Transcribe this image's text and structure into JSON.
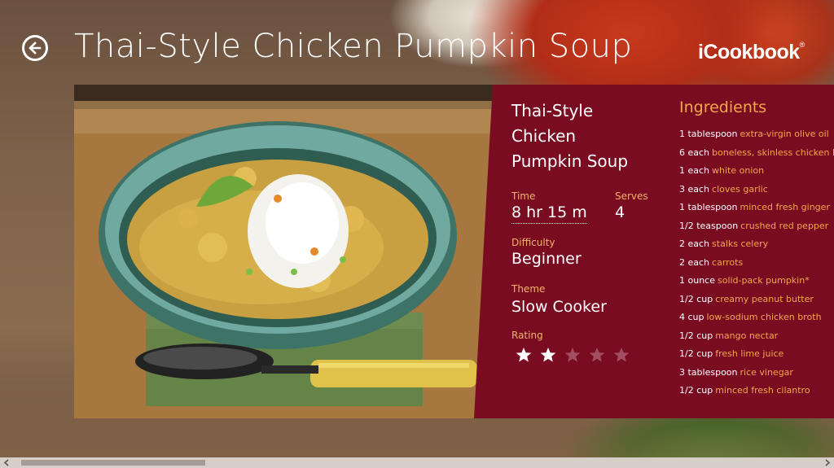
{
  "header": {
    "title": "Thai-Style Chicken Pumpkin Soup",
    "logo_text": "iCookbook",
    "logo_tm": "®"
  },
  "details": {
    "name_lines": [
      "Thai-Style",
      "Chicken",
      "Pumpkin Soup"
    ],
    "time_label": "Time",
    "time_value": "8 hr 15 m",
    "serves_label": "Serves",
    "serves_value": "4",
    "difficulty_label": "Difficulty",
    "difficulty_value": "Beginner",
    "theme_label": "Theme",
    "theme_value": "Slow Cooker",
    "rating_label": "Rating",
    "rating": 2,
    "rating_max": 5
  },
  "ingredients": {
    "title": "Ingredients",
    "items": [
      {
        "qty": "1 tablespoon",
        "name": "extra-virgin olive oil"
      },
      {
        "qty": "6 each",
        "name": "boneless, skinless chicken breas"
      },
      {
        "qty": "1 each",
        "name": "white onion"
      },
      {
        "qty": "3 each",
        "name": "cloves garlic"
      },
      {
        "qty": "1 tablespoon",
        "name": "minced fresh ginger"
      },
      {
        "qty": "1/2 teaspoon",
        "name": "crushed red pepper"
      },
      {
        "qty": "2 each",
        "name": "stalks celery"
      },
      {
        "qty": "2 each",
        "name": "carrots"
      },
      {
        "qty": "1 ounce",
        "name": "solid-pack pumpkin*"
      },
      {
        "qty": "1/2 cup",
        "name": "creamy peanut butter"
      },
      {
        "qty": "4 cup",
        "name": "low-sodium chicken broth"
      },
      {
        "qty": "1/2 cup",
        "name": "mango nectar"
      },
      {
        "qty": "1/2 cup",
        "name": "fresh lime juice"
      },
      {
        "qty": "3 tablespoon",
        "name": "rice vinegar"
      },
      {
        "qty": "1/2 cup",
        "name": "minced fresh cilantro"
      }
    ]
  },
  "colors": {
    "panel": "#7a0c22",
    "accent": "#f3a64a",
    "star_filled": "#ffffff",
    "star_empty": "#a24d62"
  },
  "scroll": {
    "position": 0.0
  }
}
